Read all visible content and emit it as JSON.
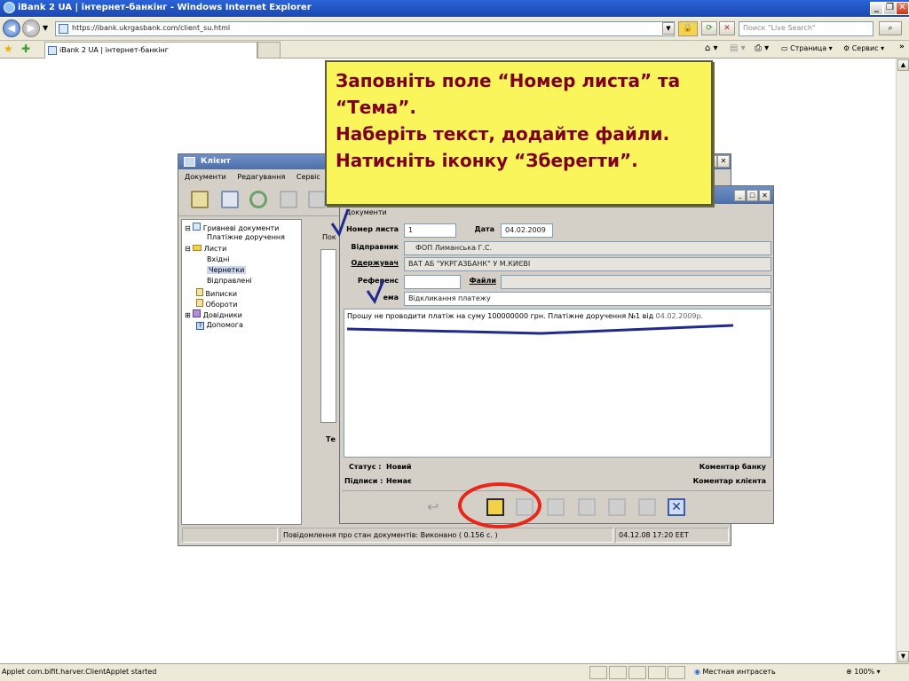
{
  "browser": {
    "title": "iBank 2 UA | інтернет-банкінг - Windows Internet Explorer",
    "url": "https://ibank.ukrgasbank.com/client_su.html",
    "search_placeholder": "Поиск \"Live Search\"",
    "tab_label": "iBank 2 UA | інтернет-банкінг",
    "cmd_page": "Страница",
    "cmd_service": "Сервис",
    "status_text": "Applet com.bifit.harver.ClientApplet started",
    "zone": "Местная интрасеть",
    "zoom": "100%",
    "colors": {
      "title": "#2a63d8",
      "chrome": "#ece9d8"
    }
  },
  "client_window": {
    "title": "Клієнт",
    "menu": [
      "Документи",
      "Редагування",
      "Сервіс"
    ],
    "tree": [
      {
        "label": "Гривневі документи",
        "indent": 0,
        "expander": "⊟"
      },
      {
        "label": "Платіжне доручення",
        "indent": 1,
        "expander": ""
      },
      {
        "label": "Листи",
        "indent": 0,
        "expander": "⊟"
      },
      {
        "label": "Вхідні",
        "indent": 1,
        "expander": ""
      },
      {
        "label": "Чернетки",
        "indent": 1,
        "expander": "",
        "selected": true
      },
      {
        "label": "Відправлені",
        "indent": 1,
        "expander": ""
      },
      {
        "label": "Виписки",
        "indent": 0,
        "expander": ""
      },
      {
        "label": "Обороти",
        "indent": 0,
        "expander": ""
      },
      {
        "label": "Довідники",
        "indent": 0,
        "expander": "⊞"
      },
      {
        "label": "Допомога",
        "indent": 0,
        "expander": ""
      }
    ],
    "right_label_1": "Пок",
    "right_label_2": "Те",
    "status_message": "Повідомлення про стан документів: Виконано ( 0.156 с. )",
    "status_time": "04.12.08 17:20 EET"
  },
  "letter_dialog": {
    "section": "Документи",
    "number_label": "Номер листа",
    "number_value": "1",
    "date_label": "Дата",
    "date_value": "04.02.2009",
    "sender_label": "Відправник",
    "sender_value": "ФОП Лиманська Г.С.",
    "receiver_label": "Одержувач",
    "receiver_value": "ВАТ АБ \"УКРГАЗБАНК\" У М.КИЄВІ",
    "reference_label": "Референс",
    "files_label": "Файли",
    "subject_label": "ема",
    "subject_value": "Відкликання платежу",
    "body_text": "Прошу не проводити платіж на суму 100000000 грн. Платіжне доручення №1 від",
    "body_date": "04.02.2009р.",
    "status_label": "Статус :",
    "status_value": "Новий",
    "signs_label": "Підписи :",
    "signs_value": "Немає",
    "bank_comment": "Коментар банку",
    "client_comment": "Коментар клієнта",
    "toolbar_icons": [
      "undo-icon",
      "save-icon",
      "edit-icon",
      "sign-icon",
      "copy-icon",
      "print-icon",
      "delete-icon",
      "close-icon"
    ]
  },
  "annotation": {
    "lines": [
      "Заповніть поле “Номер листа” та “Тема”.",
      "Наберіть текст, додайте файли.",
      "Натисніть іконку “Зберегти”."
    ],
    "colors": {
      "background": "#f9f55b",
      "text": "#800020",
      "highlight_circle": "#e8261a",
      "underline": "#1f2a8c"
    }
  }
}
